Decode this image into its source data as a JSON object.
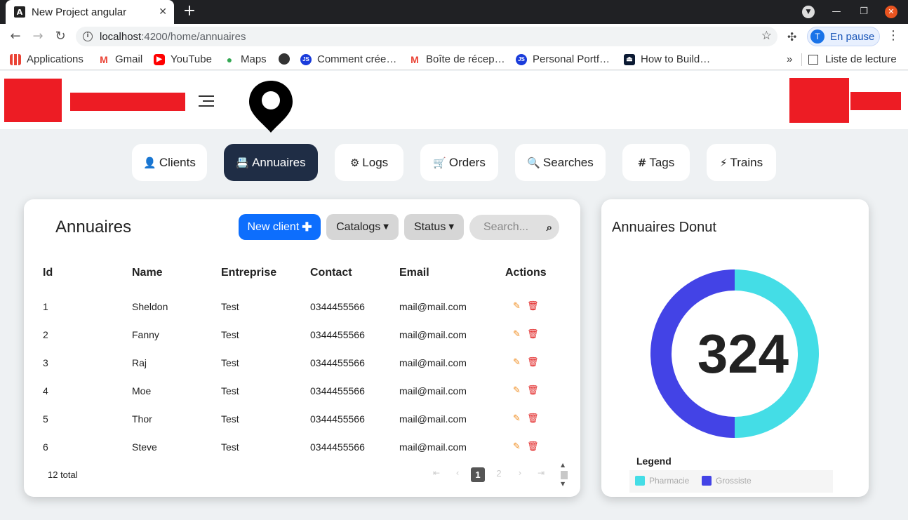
{
  "browser": {
    "tab_title": "New Project angular",
    "tab_icon_letter": "A",
    "url_host": "localhost",
    "url_path": ":4200/home/annuaires",
    "profile_initial": "T",
    "profile_label": "En pause",
    "bookmarks": [
      {
        "label": "Applications",
        "icon": "apps-grid-icon"
      },
      {
        "label": "Gmail",
        "icon": "gmail-icon"
      },
      {
        "label": "YouTube",
        "icon": "youtube-icon"
      },
      {
        "label": "Maps",
        "icon": "maps-icon"
      },
      {
        "label": "",
        "icon": "globe-icon"
      },
      {
        "label": "Comment crée…",
        "icon": "js-icon"
      },
      {
        "label": "Boîte de récep…",
        "icon": "gmail-icon"
      },
      {
        "label": "Personal Portf…",
        "icon": "js-icon"
      },
      {
        "label": "How to Build…",
        "icon": "site-icon"
      }
    ],
    "reading_list": "Liste de lecture"
  },
  "nav": [
    {
      "label": "Clients",
      "icon": "user-icon"
    },
    {
      "label": "Annuaires",
      "icon": "address-book-icon",
      "active": true
    },
    {
      "label": "Logs",
      "icon": "cogs-icon"
    },
    {
      "label": "Orders",
      "icon": "cart-icon"
    },
    {
      "label": "Searches",
      "icon": "search-icon"
    },
    {
      "label": "Tags",
      "icon": "hashtag-icon"
    },
    {
      "label": "Trains",
      "icon": "bolt-icon"
    }
  ],
  "annuaires": {
    "title": "Annuaires",
    "new_client": "New client",
    "catalogs": "Catalogs",
    "status": "Status",
    "search_placeholder": "Search...",
    "columns": [
      "Id",
      "Name",
      "Entreprise",
      "Contact",
      "Email",
      "Actions"
    ],
    "rows": [
      [
        "1",
        "Sheldon",
        "Test",
        "0344455566",
        "mail@mail.com"
      ],
      [
        "2",
        "Fanny",
        "Test",
        "0344455566",
        "mail@mail.com"
      ],
      [
        "3",
        "Raj",
        "Test",
        "0344455566",
        "mail@mail.com"
      ],
      [
        "4",
        "Moe",
        "Test",
        "0344455566",
        "mail@mail.com"
      ],
      [
        "5",
        "Thor",
        "Test",
        "0344455566",
        "mail@mail.com"
      ],
      [
        "6",
        "Steve",
        "Test",
        "0344455566",
        "mail@mail.com"
      ]
    ],
    "total": "12 total",
    "pages": [
      "1",
      "2"
    ],
    "current_page": "1"
  },
  "donut": {
    "title": "Annuaires Donut",
    "center_value": "324",
    "legend_title": "Legend",
    "chart_data": {
      "type": "pie",
      "slices": [
        {
          "name": "Pharmacie",
          "value": 0.5,
          "color": "#44dde6"
        },
        {
          "name": "Grossiste",
          "value": 0.5,
          "color": "#4343e6"
        }
      ]
    }
  },
  "colors": {
    "primary": "#0d6efd",
    "nav_active": "#1f2d45",
    "brand_red": "#ed1c24",
    "edit": "#f08c1f",
    "delete": "#e01b1b"
  }
}
